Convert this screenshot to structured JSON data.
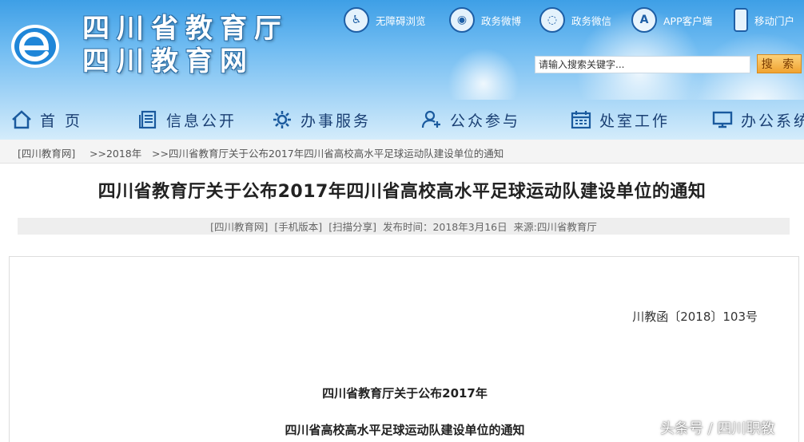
{
  "header": {
    "site_name_line1": "四川省教育厅",
    "site_name_line2": "四川教育网",
    "logo_icon": "e-logo-icon",
    "quick_links": [
      {
        "label": "无障碍浏览",
        "icon": "accessibility-icon"
      },
      {
        "label": "政务微博",
        "icon": "weibo-icon"
      },
      {
        "label": "政务微信",
        "icon": "wechat-icon"
      },
      {
        "label": "APP客户端",
        "icon": "app-store-icon"
      },
      {
        "label": "移动门户",
        "icon": "mobile-phone-icon"
      }
    ],
    "search": {
      "placeholder": "请输入搜索关键字...",
      "button_label": "搜 索"
    }
  },
  "nav": {
    "items": [
      {
        "label": "首 页",
        "icon": "home-icon"
      },
      {
        "label": "信息公开",
        "icon": "document-icon"
      },
      {
        "label": "办事服务",
        "icon": "gear-icon"
      },
      {
        "label": "公众参与",
        "icon": "user-add-icon"
      },
      {
        "label": "处室工作",
        "icon": "calendar-icon"
      },
      {
        "label": "办公系统",
        "icon": "monitor-icon"
      }
    ]
  },
  "breadcrumb": {
    "items": [
      "[四川教育网]",
      ">>2018年",
      ">>四川省教育厅关于公布2017年四川省高校高水平足球运动队建设单位的通知"
    ]
  },
  "article": {
    "title": "四川省教育厅关于公布2017年四川省高校高水平足球运动队建设单位的通知",
    "meta": {
      "site_link": "[四川教育网]",
      "mobile_link": "[手机版本]",
      "share_link": "[扫描分享]",
      "publish_time": "发布时间：2018年3月16日",
      "source": "来源:四川省教育厅"
    },
    "doc_number": "川教函〔2018〕103号",
    "heading_line1": "四川省教育厅关于公布2017年",
    "heading_line2": "四川省高校高水平足球运动队建设单位的通知"
  },
  "watermark": "头条号 / 四川职教",
  "colors": {
    "header_blue": "#3e9fe6",
    "nav_text": "#1a3f73",
    "search_button": "#f0a330"
  }
}
